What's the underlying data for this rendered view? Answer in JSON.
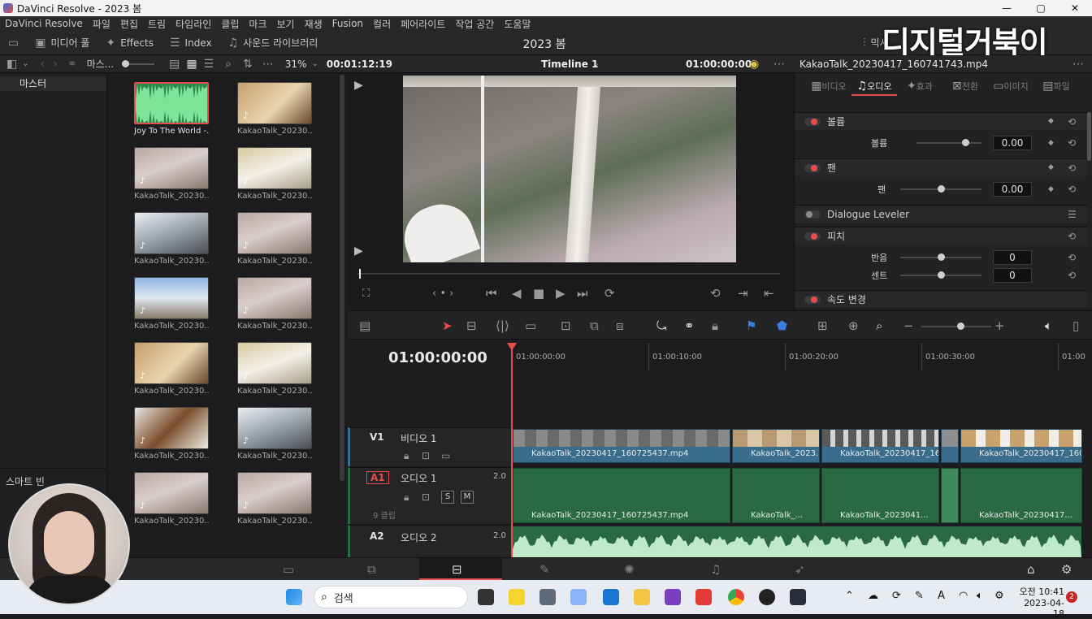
{
  "window": {
    "title": "DaVinci Resolve - 2023 봄",
    "min": "—",
    "max": "▢",
    "close": "✕"
  },
  "menu": [
    "DaVinci Resolve",
    "파일",
    "편집",
    "트림",
    "타임라인",
    "클립",
    "마크",
    "보기",
    "재생",
    "Fusion",
    "컬러",
    "페어라이트",
    "작업 공간",
    "도움말"
  ],
  "toolbar": {
    "media_pool": "미디어 풀",
    "effects": "Effects",
    "index": "Index",
    "sound_library": "사운드 라이브러리",
    "project_title": "2023 봄",
    "mixer": "믹서"
  },
  "watermark": "디지털거북이",
  "subbar": {
    "bin_path": "마스...",
    "zoom": "31%",
    "timecode": "00:01:12:19",
    "timeline_name": "Timeline 1",
    "timeline_tc": "01:00:00:00",
    "clip_name": "KakaoTalk_20230417_160741743.mp4"
  },
  "bins": {
    "master": "마스터",
    "smart_bins": "스마트 빈"
  },
  "media": [
    {
      "label": "Joy To The World -...",
      "kind": "audio"
    },
    {
      "label": "KakaoTalk_20230...",
      "kind": "food"
    },
    {
      "label": "KakaoTalk_20230...",
      "kind": "blossom"
    },
    {
      "label": "KakaoTalk_20230...",
      "kind": "room"
    },
    {
      "label": "KakaoTalk_20230...",
      "kind": "building"
    },
    {
      "label": "KakaoTalk_20230...",
      "kind": "blossom"
    },
    {
      "label": "KakaoTalk_20230...",
      "kind": "sky"
    },
    {
      "label": "KakaoTalk_20230...",
      "kind": "blossom"
    },
    {
      "label": "KakaoTalk_20230...",
      "kind": "food"
    },
    {
      "label": "KakaoTalk_20230...",
      "kind": "room"
    },
    {
      "label": "KakaoTalk_20230...",
      "kind": "coffee"
    },
    {
      "label": "KakaoTalk_20230...",
      "kind": "building"
    },
    {
      "label": "KakaoTalk_20230...",
      "kind": "blossom"
    },
    {
      "label": "KakaoTalk_20230...",
      "kind": "blossom"
    }
  ],
  "inspector": {
    "tabs": [
      "비디오",
      "오디오",
      "효과",
      "전환",
      "이미지",
      "파일"
    ],
    "volume_section": "볼륨",
    "volume_label": "볼륨",
    "volume_value": "0.00",
    "pan_section": "팬",
    "pan_label": "팬",
    "pan_value": "0.00",
    "dialogue": "Dialogue Leveler",
    "pitch_section": "피치",
    "semitone_label": "반음",
    "semitone_value": "0",
    "cents_label": "센트",
    "cents_value": "0",
    "speed_section": "속도 변경"
  },
  "timeline": {
    "timecode": "01:00:00:00",
    "ruler": [
      "01:00:00:00",
      "01:00:10:00",
      "01:00:20:00",
      "01:00:30:00",
      "01:00"
    ],
    "v1": {
      "id": "V1",
      "name": "비디오 1"
    },
    "a1": {
      "id": "A1",
      "name": "오디오 1",
      "level": "2.0",
      "clips": "9 클립",
      "solo": "S",
      "mute": "M"
    },
    "a2": {
      "id": "A2",
      "name": "오디오 2",
      "level": "2.0"
    },
    "video_clips": [
      "KakaoTalk_20230417_160725437.mp4",
      "KakaoTalk_2023...",
      "KakaoTalk_20230417_16...",
      "KakaoTalk_20230417_160..."
    ],
    "audio_clips": [
      "KakaoTalk_20230417_160725437.mp4",
      "KakaoTalk_...",
      "KakaoTalk_2023041...",
      "KakaoTalk_20230417..."
    ]
  },
  "taskbar": {
    "search": "검색",
    "time": "오전 10:41",
    "date": "2023-04-18",
    "badge": "2"
  }
}
